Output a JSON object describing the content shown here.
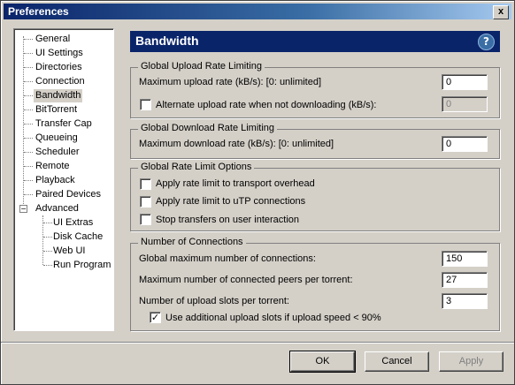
{
  "window": {
    "title": "Preferences",
    "close_glyph": "x"
  },
  "tree": {
    "items": [
      "General",
      "UI Settings",
      "Directories",
      "Connection",
      "Bandwidth",
      "BitTorrent",
      "Transfer Cap",
      "Queueing",
      "Scheduler",
      "Remote",
      "Playback",
      "Paired Devices",
      "Advanced"
    ],
    "advanced_children": [
      "UI Extras",
      "Disk Cache",
      "Web UI",
      "Run Program"
    ],
    "selected": "Bandwidth",
    "expander_glyph": "−"
  },
  "panel": {
    "title": "Bandwidth",
    "help_glyph": "?"
  },
  "upload_group": {
    "title": "Global Upload Rate Limiting",
    "max_label": "Maximum upload rate (kB/s): [0: unlimited]",
    "max_value": "0",
    "alt_label": "Alternate upload rate when not downloading (kB/s):",
    "alt_checked": false,
    "alt_value": "0"
  },
  "download_group": {
    "title": "Global Download Rate Limiting",
    "max_label": "Maximum download rate (kB/s): [0: unlimited]",
    "max_value": "0"
  },
  "options_group": {
    "title": "Global Rate Limit Options",
    "items": [
      {
        "label": "Apply rate limit to transport overhead",
        "checked": false
      },
      {
        "label": "Apply rate limit to uTP connections",
        "checked": false
      },
      {
        "label": "Stop transfers on user interaction",
        "checked": false
      }
    ]
  },
  "connections_group": {
    "title": "Number of Connections",
    "global_label": "Global maximum number of connections:",
    "global_value": "150",
    "peers_label": "Maximum number of connected peers per torrent:",
    "peers_value": "27",
    "slots_label": "Number of upload slots per torrent:",
    "slots_value": "3",
    "extra_slots_label": "Use additional upload slots if upload speed < 90%",
    "extra_slots_checked": true,
    "check_glyph": "✓"
  },
  "buttons": {
    "ok": "OK",
    "cancel": "Cancel",
    "apply": "Apply"
  }
}
